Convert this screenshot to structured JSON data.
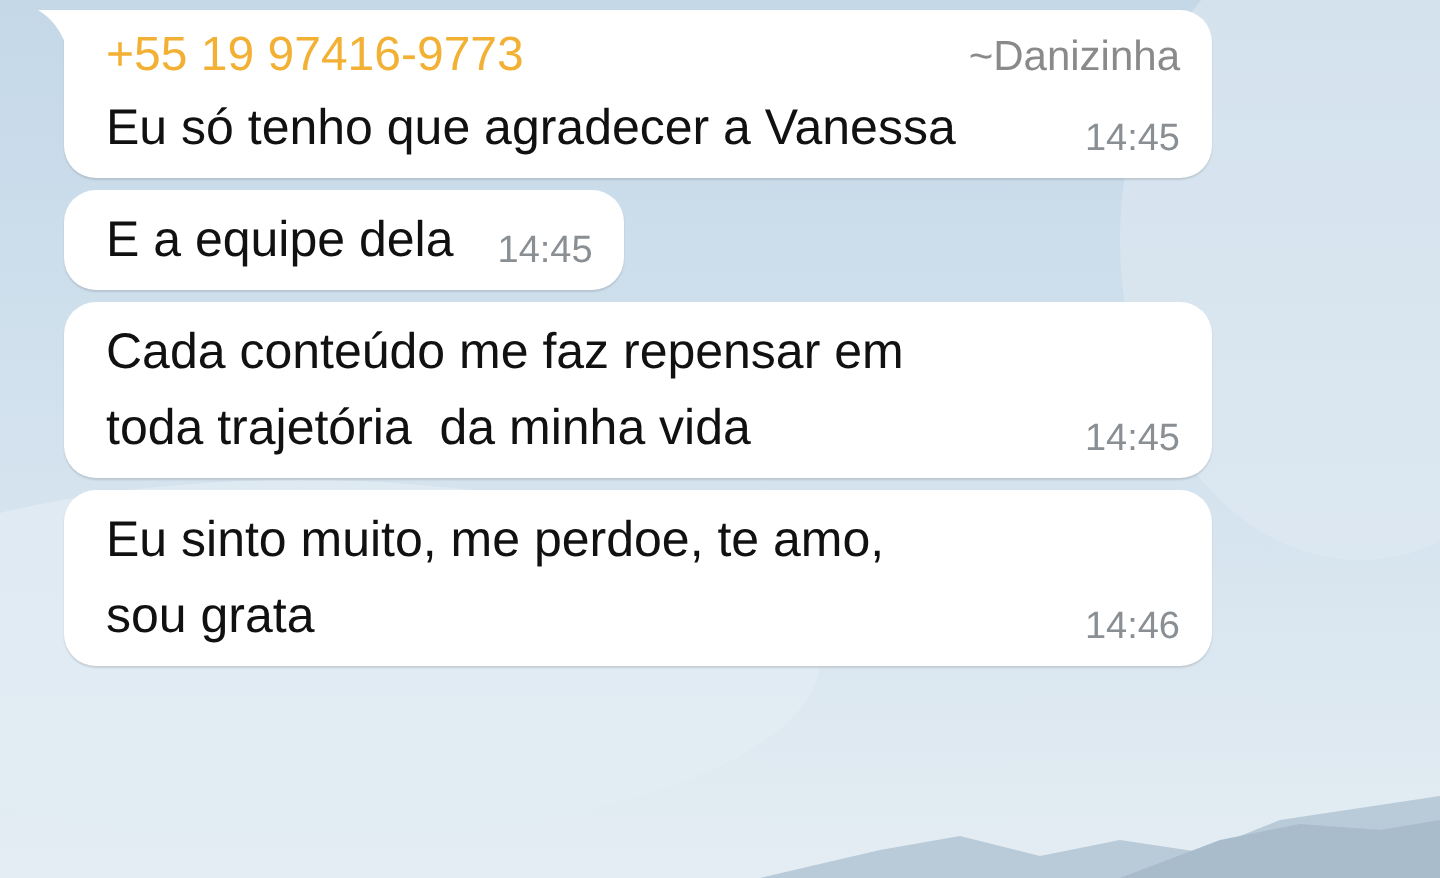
{
  "messages": [
    {
      "sender": {
        "phone": "+55 19 97416-9773",
        "name": "~Danizinha"
      },
      "lines": [
        "Eu só tenho que agradecer a Vanessa"
      ],
      "time": "14:45",
      "tail": true
    },
    {
      "lines": [
        "E a equipe dela"
      ],
      "time": "14:45",
      "tail": false
    },
    {
      "lines": [
        "Cada conteúdo me faz repensar em",
        "toda trajetória  da minha vida"
      ],
      "time": "14:45",
      "tail": false
    },
    {
      "lines": [
        "Eu sinto muito, me perdoe, te amo,",
        "sou grata"
      ],
      "time": "14:46",
      "tail": false
    }
  ]
}
